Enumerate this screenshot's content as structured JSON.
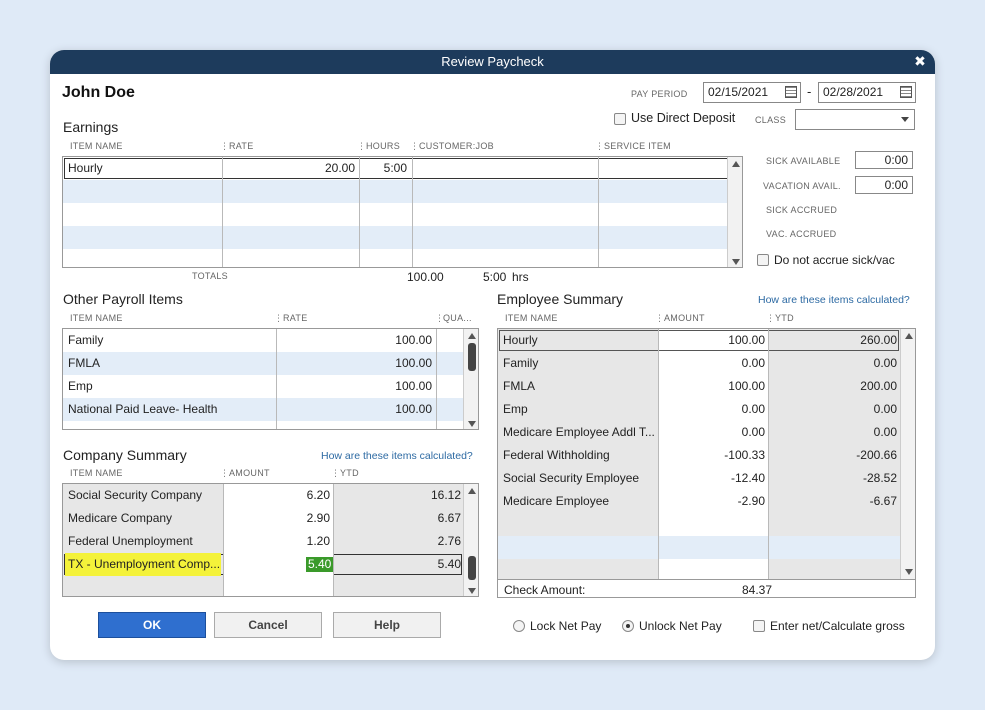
{
  "window": {
    "title": "Review Paycheck",
    "close_glyph": "✖"
  },
  "employee_name": "John Doe",
  "pay_period": {
    "label": "PAY PERIOD",
    "start": "02/15/2021",
    "end": "02/28/2021",
    "separator": "-"
  },
  "direct_deposit_label": "Use Direct Deposit",
  "class_label": "CLASS",
  "earnings": {
    "title": "Earnings",
    "headers": {
      "item": "ITEM NAME",
      "rate": "RATE",
      "hours": "HOURS",
      "job": "CUSTOMER:JOB",
      "service": "SERVICE ITEM"
    },
    "rows": [
      {
        "item": "Hourly",
        "rate": "20.00",
        "hours": "5:00",
        "job": "",
        "service": ""
      }
    ],
    "totals_label": "TOTALS",
    "total_amount": "100.00",
    "total_hours": "5:00",
    "hours_unit": "hrs"
  },
  "sick_vacation": {
    "sick_available_label": "SICK AVAILABLE",
    "sick_available": "0:00",
    "vacation_avail_label": "VACATION AVAIL.",
    "vacation_avail": "0:00",
    "sick_accrued_label": "SICK ACCRUED",
    "vac_accrued_label": "VAC. ACCRUED",
    "no_accrue_label": "Do not accrue sick/vac"
  },
  "other_payroll": {
    "title": "Other Payroll Items",
    "headers": {
      "item": "ITEM NAME",
      "rate": "RATE",
      "qty": "QUA..."
    },
    "rows": [
      {
        "item": "Family",
        "rate": "100.00"
      },
      {
        "item": "FMLA",
        "rate": "100.00"
      },
      {
        "item": "Emp",
        "rate": "100.00"
      },
      {
        "item": "National Paid Leave- Health",
        "rate": "100.00"
      }
    ]
  },
  "employee_summary": {
    "title": "Employee Summary",
    "link": "How are these items calculated?",
    "headers": {
      "item": "ITEM NAME",
      "amount": "AMOUNT",
      "ytd": "YTD"
    },
    "rows": [
      {
        "item": "Hourly",
        "amount": "100.00",
        "ytd": "260.00"
      },
      {
        "item": "Family",
        "amount": "0.00",
        "ytd": "0.00"
      },
      {
        "item": "FMLA",
        "amount": "100.00",
        "ytd": "200.00"
      },
      {
        "item": "Emp",
        "amount": "0.00",
        "ytd": "0.00"
      },
      {
        "item": "Medicare Employee Addl T...",
        "amount": "0.00",
        "ytd": "0.00"
      },
      {
        "item": "Federal Withholding",
        "amount": "-100.33",
        "ytd": "-200.66"
      },
      {
        "item": "Social Security Employee",
        "amount": "-12.40",
        "ytd": "-28.52"
      },
      {
        "item": "Medicare Employee",
        "amount": "-2.90",
        "ytd": "-6.67"
      }
    ],
    "check_amount_label": "Check Amount:",
    "check_amount": "84.37"
  },
  "company_summary": {
    "title": "Company Summary",
    "link": "How are these items calculated?",
    "headers": {
      "item": "ITEM NAME",
      "amount": "AMOUNT",
      "ytd": "YTD"
    },
    "rows": [
      {
        "item": "Social Security Company",
        "amount": "6.20",
        "ytd": "16.12"
      },
      {
        "item": "Medicare Company",
        "amount": "2.90",
        "ytd": "6.67"
      },
      {
        "item": "Federal Unemployment",
        "amount": "1.20",
        "ytd": "2.76"
      },
      {
        "item": "TX - Unemployment Comp...",
        "amount": "5.40",
        "ytd": "5.40"
      }
    ]
  },
  "buttons": {
    "ok": "OK",
    "cancel": "Cancel",
    "help": "Help"
  },
  "options": {
    "lock_net_pay": "Lock Net Pay",
    "unlock_net_pay": "Unlock Net Pay",
    "enter_net": "Enter net/Calculate gross",
    "selected": "Unlock Net Pay"
  },
  "colors": {
    "titlebar": "#1d3b5c",
    "highlight_yellow": "#f4f23a",
    "selected_green": "#3a9a2a",
    "primary_button": "#2f6fcf",
    "row_alt": "#e3edf8"
  }
}
